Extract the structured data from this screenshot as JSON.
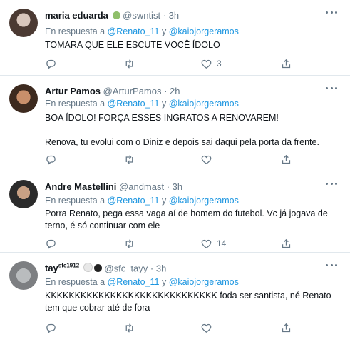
{
  "reply_label": "En respuesta a",
  "reply_conjunction": "y",
  "tweets": [
    {
      "name": "maria eduarda",
      "handle": "@swntist",
      "time": "· 3h",
      "reply_to": [
        "@Renato_11",
        "@kaiojorgeramos"
      ],
      "lines": [
        "TOMARA QUE ELE ESCUTE VOCÊ ÍDOLO"
      ],
      "likes": "3"
    },
    {
      "name": "Artur Pamos",
      "handle": "@ArturPamos",
      "time": "· 2h",
      "reply_to": [
        "@Renato_11",
        "@kaiojorgeramos"
      ],
      "lines": [
        "BOA ÍDOLO! FORÇA ESSES INGRATOS A RENOVAREM!",
        "Renova, tu evolui com o Diniz e depois sai daqui pela porta da frente."
      ],
      "likes": ""
    },
    {
      "name": "Andre Mastellini",
      "handle": "@andmast",
      "time": "· 3h",
      "reply_to": [
        "@Renato_11",
        "@kaiojorgeramos"
      ],
      "lines": [
        "Porra Renato, pega essa vaga aí de homem do futebol. Vc já jogava de",
        "terno, é só continuar com ele"
      ],
      "likes": "14"
    },
    {
      "name": "tay",
      "name_sup": "sfc1912",
      "handle": "@sfc_tayy",
      "time": "· 3h",
      "reply_to": [
        "@Renato_11",
        "@kaiojorgeramos"
      ],
      "lines": [
        "KKKKKKKKKKKKKKKKKKKKKKKKKKKKK foda ser santista, né Renato",
        "tem que cobrar até de fora"
      ],
      "likes": ""
    }
  ],
  "icons": {
    "reply": "reply-icon",
    "retweet": "retweet-icon",
    "like": "heart-icon",
    "share": "share-icon",
    "more": "more-icon"
  },
  "colors": {
    "link": "#1b95e0",
    "muted": "#657786",
    "text": "#0f1419",
    "divider": "#e1e8ed"
  }
}
